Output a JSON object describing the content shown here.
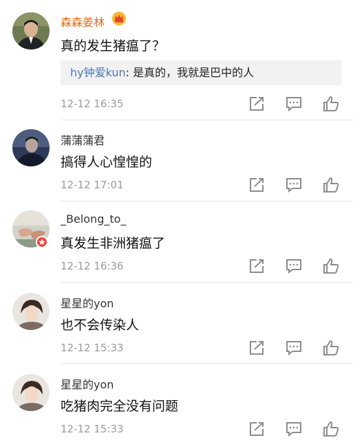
{
  "comments": [
    {
      "username": "森森姜林",
      "text": "真的发生猪瘟了？",
      "time": "12-12 16:35",
      "reply": {
        "name": "hy钟爱kun",
        "text": ": 是真的，我就是巴中的人"
      }
    },
    {
      "username": "蒲蒲蒲君",
      "text": "搞得人心惶惶的",
      "time": "12-12 17:01"
    },
    {
      "username": "_Belong_to_",
      "text": "真发生非洲猪瘟了",
      "time": "12-12 16:36"
    },
    {
      "username": "星星的yon",
      "text": "也不会传染人",
      "time": "12-12 15:33"
    },
    {
      "username": "星星的yon",
      "text": "吃猪肉完全没有问题",
      "time": "12-12 15:33"
    }
  ],
  "colors": {
    "vip_name": "#e86a12",
    "reply_name": "#4a78b5",
    "time": "#9a9a9a",
    "icon": "#8c8c8c"
  },
  "icons": {
    "forward": "share-square-icon",
    "comment": "comment-bubble-icon",
    "like": "thumbs-up-icon",
    "vip": "crown-icon"
  }
}
